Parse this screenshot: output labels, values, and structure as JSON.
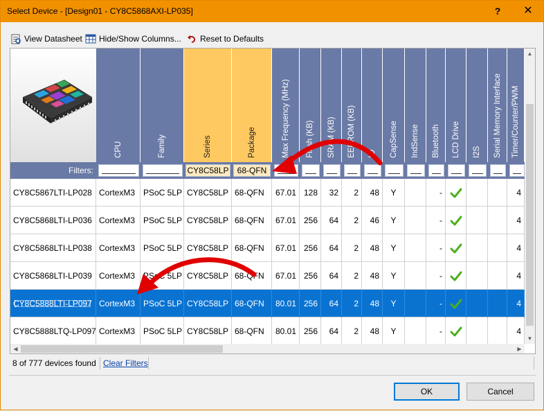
{
  "window": {
    "title": "Select Device - [Design01 - CY8C5868AXI-LP035]",
    "help_glyph": "?",
    "close_glyph": "✕"
  },
  "toolbar": {
    "view_datasheet": "View Datasheet",
    "hide_show_columns": "Hide/Show Columns...",
    "reset_defaults": "Reset to Defaults"
  },
  "columns": [
    {
      "key": "cpu",
      "label": "CPU"
    },
    {
      "key": "family",
      "label": "Family"
    },
    {
      "key": "series",
      "label": "Series",
      "highlight": true
    },
    {
      "key": "package",
      "label": "Package",
      "highlight": true
    },
    {
      "key": "maxfreq",
      "label": "Max Frequency (MHz)"
    },
    {
      "key": "flash",
      "label": "Flash (KB)"
    },
    {
      "key": "sram",
      "label": "SRAM (KB)"
    },
    {
      "key": "eeprom",
      "label": "EEPROM (KB)"
    },
    {
      "key": "io",
      "label": "IO"
    },
    {
      "key": "capsense",
      "label": "CapSense"
    },
    {
      "key": "indsense",
      "label": "IndSense"
    },
    {
      "key": "bluetooth",
      "label": "Bluetooth"
    },
    {
      "key": "lcd",
      "label": "LCD Drive"
    },
    {
      "key": "i2s",
      "label": "I2S"
    },
    {
      "key": "smi",
      "label": "Serial Memory Interface"
    },
    {
      "key": "tcpwm",
      "label": "Timer/Counter/PWM"
    }
  ],
  "filters": {
    "label": "Filters:",
    "series": "CY8C58LP",
    "package": "68-QFN"
  },
  "rows": [
    {
      "part": "CY8C5867LTI-LP028",
      "cpu": "CortexM3",
      "family": "PSoC 5LP",
      "series": "CY8C58LP",
      "package": "68-QFN",
      "maxfreq": "67.01",
      "flash": "128",
      "sram": "32",
      "eeprom": "2",
      "io": "48",
      "capsense": "Y",
      "bluetooth": "-",
      "lcd": "check",
      "tcpwm": "4"
    },
    {
      "part": "CY8C5868LTI-LP036",
      "cpu": "CortexM3",
      "family": "PSoC 5LP",
      "series": "CY8C58LP",
      "package": "68-QFN",
      "maxfreq": "67.01",
      "flash": "256",
      "sram": "64",
      "eeprom": "2",
      "io": "46",
      "capsense": "Y",
      "bluetooth": "-",
      "lcd": "check",
      "tcpwm": "4"
    },
    {
      "part": "CY8C5868LTI-LP038",
      "cpu": "CortexM3",
      "family": "PSoC 5LP",
      "series": "CY8C58LP",
      "package": "68-QFN",
      "maxfreq": "67.01",
      "flash": "256",
      "sram": "64",
      "eeprom": "2",
      "io": "48",
      "capsense": "Y",
      "bluetooth": "-",
      "lcd": "check",
      "tcpwm": "4"
    },
    {
      "part": "CY8C5868LTI-LP039",
      "cpu": "CortexM3",
      "family": "PSoC 5LP",
      "series": "CY8C58LP",
      "package": "68-QFN",
      "maxfreq": "67.01",
      "flash": "256",
      "sram": "64",
      "eeprom": "2",
      "io": "48",
      "capsense": "Y",
      "bluetooth": "-",
      "lcd": "check",
      "tcpwm": "4"
    },
    {
      "part": "CY8C5888LTI-LP097",
      "cpu": "CortexM3",
      "family": "PSoC 5LP",
      "series": "CY8C58LP",
      "package": "68-QFN",
      "maxfreq": "80.01",
      "flash": "256",
      "sram": "64",
      "eeprom": "2",
      "io": "48",
      "capsense": "Y",
      "bluetooth": "-",
      "lcd": "check",
      "tcpwm": "4",
      "selected": true
    },
    {
      "part": "CY8C5888LTQ-LP097",
      "cpu": "CortexM3",
      "family": "PSoC 5LP",
      "series": "CY8C58LP",
      "package": "68-QFN",
      "maxfreq": "80.01",
      "flash": "256",
      "sram": "64",
      "eeprom": "2",
      "io": "48",
      "capsense": "Y",
      "bluetooth": "-",
      "lcd": "check",
      "tcpwm": "4"
    }
  ],
  "status": {
    "count": "8 of 777 devices found",
    "clear_filters": "Clear Filters"
  },
  "buttons": {
    "ok": "OK",
    "cancel": "Cancel"
  },
  "colors": {
    "titlebar": "#f29100",
    "header": "#6a7aa6",
    "header_highlight": "#ffc962",
    "selection": "#0a73d2",
    "annotation_arrow": "#e00000",
    "check": "#4caf1e"
  }
}
